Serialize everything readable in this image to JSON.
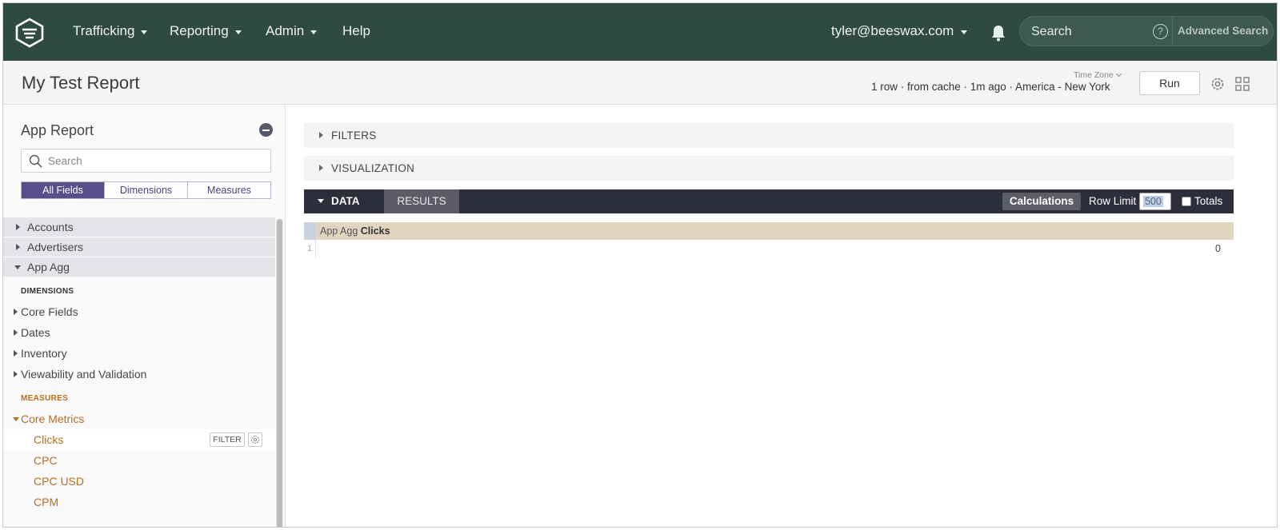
{
  "nav": {
    "items": [
      {
        "label": "Trafficking",
        "has_menu": true
      },
      {
        "label": "Reporting",
        "has_menu": true
      },
      {
        "label": "Admin",
        "has_menu": true
      },
      {
        "label": "Help",
        "has_menu": false
      }
    ],
    "user": "tyler@beeswax.com",
    "search_placeholder": "Search",
    "advanced_search": "Advanced Search",
    "help_glyph": "?",
    "bg_color": "#2f4b41"
  },
  "titlebar": {
    "title": "My Test Report",
    "meta": "1 row · from cache · 1m ago · America - New York",
    "timezone_label": "Time Zone",
    "run_label": "Run"
  },
  "sidebar": {
    "title": "App Report",
    "search_placeholder": "Search",
    "field_tabs": [
      "All Fields",
      "Dimensions",
      "Measures"
    ],
    "active_field_tab": "All Fields",
    "views": [
      "Accounts",
      "Advertisers",
      "App Agg"
    ],
    "expanded_view": "App Agg",
    "dimensions_label": "DIMENSIONS",
    "dimension_groups": [
      "Core Fields",
      "Dates",
      "Inventory",
      "Viewability and Validation"
    ],
    "measures_label": "MEASURES",
    "measure_group": "Core Metrics",
    "measure_items": [
      "Clicks",
      "CPC",
      "CPC USD",
      "CPM"
    ],
    "selected_measure": "Clicks",
    "filter_chip": "FILTER",
    "measure_color": "#b86e1e",
    "active_tab_color": "#5a4e8a"
  },
  "main": {
    "filters_label": "FILTERS",
    "visualization_label": "VISUALIZATION",
    "data_tab": "DATA",
    "results_tab": "RESULTS",
    "calculations": "Calculations",
    "row_limit_label": "Row Limit",
    "row_limit_value": "500",
    "totals_label": "Totals",
    "column_view": "App Agg",
    "column_field": "Clicks",
    "rows": [
      {
        "num": "1",
        "value": "0"
      }
    ]
  }
}
